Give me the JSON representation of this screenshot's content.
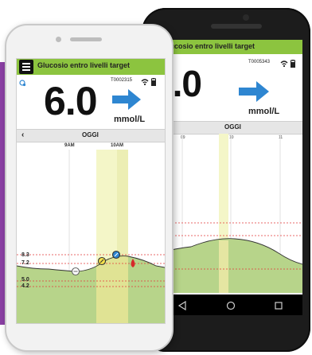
{
  "app": {
    "title": "Glucosio entro livelli target"
  },
  "front": {
    "sensor_id": "T0002315",
    "reading": "6.0",
    "unit": "mmol/L",
    "day": "OGGI",
    "times": [
      "9AM",
      "10AM"
    ],
    "y_labels": [
      "8.3",
      "7.2",
      "5.0",
      "4.2"
    ]
  },
  "back": {
    "sensor_id": "T0005343",
    "reading": "6.0",
    "unit": "mmol/L",
    "day": "OGGI",
    "times": [
      "09",
      "10",
      "11"
    ]
  },
  "colors": {
    "header": "#8cc43f",
    "arrow": "#2e86d1",
    "target_line": "#e23a3a",
    "purple": "#8a3fa3"
  }
}
